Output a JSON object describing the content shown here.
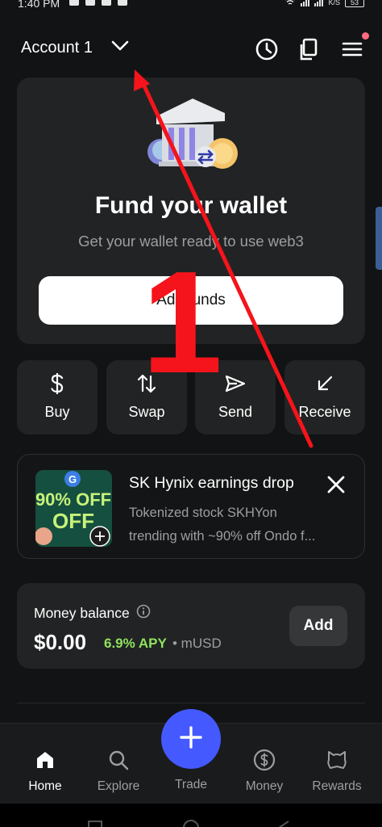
{
  "status_bar": {
    "time": "1:40 PM",
    "network": "K/S",
    "battery": "53"
  },
  "header": {
    "account_name": "Account 1",
    "icons": [
      "chevron-down-icon",
      "clock-icon",
      "copy-icon",
      "menu-icon"
    ]
  },
  "fund_card": {
    "title": "Fund your wallet",
    "subtitle": "Get your wallet ready to use web3",
    "button_label": "Add funds"
  },
  "actions": [
    {
      "label": "Buy",
      "icon": "dollar-icon"
    },
    {
      "label": "Swap",
      "icon": "swap-arrows-icon"
    },
    {
      "label": "Send",
      "icon": "send-icon"
    },
    {
      "label": "Receive",
      "icon": "receive-arrow-icon"
    }
  ],
  "promo": {
    "title": "SK Hynix earnings drop",
    "body_line1": "Tokenized stock SKHYon",
    "body_line2": "trending with ~90% off Ondo f...",
    "image_text": "90% OFF"
  },
  "money": {
    "label": "Money balance",
    "amount": "$0.00",
    "apy": "6.9% APY",
    "token": "• mUSD",
    "add_label": "Add"
  },
  "bottom_nav": [
    {
      "label": "Home",
      "icon": "home-icon",
      "active": true
    },
    {
      "label": "Explore",
      "icon": "search-icon",
      "active": false
    },
    {
      "label": "Trade",
      "icon": "plus-icon",
      "active": false
    },
    {
      "label": "Money",
      "icon": "dollar-circle-icon",
      "active": false
    },
    {
      "label": "Rewards",
      "icon": "rewards-icon",
      "active": false
    }
  ],
  "annotation": {
    "number": "1",
    "color": "#f5141b"
  },
  "colors": {
    "background": "#121314",
    "card": "#222324",
    "accent": "#4459ff",
    "apy": "#8fe35e"
  }
}
